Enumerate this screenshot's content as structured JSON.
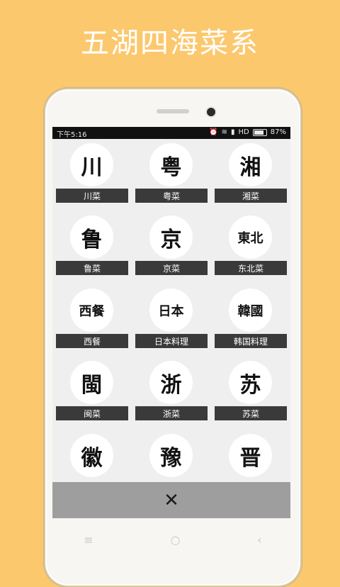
{
  "banner": {
    "title": "五湖四海菜系"
  },
  "status": {
    "time": "下午5:16",
    "network": "HD",
    "battery": "87%"
  },
  "cuisines": [
    {
      "glyph": "川",
      "label": "川菜"
    },
    {
      "glyph": "粤",
      "label": "粤菜"
    },
    {
      "glyph": "湘",
      "label": "湘菜"
    },
    {
      "glyph": "鲁",
      "label": "鲁菜"
    },
    {
      "glyph": "京",
      "label": "京菜"
    },
    {
      "glyph": "東北",
      "label": "东北菜"
    },
    {
      "glyph": "西餐",
      "label": "西餐"
    },
    {
      "glyph": "日本",
      "label": "日本料理"
    },
    {
      "glyph": "韓國",
      "label": "韩国料理"
    },
    {
      "glyph": "閩",
      "label": "闽菜"
    },
    {
      "glyph": "浙",
      "label": "浙菜"
    },
    {
      "glyph": "苏",
      "label": "苏菜"
    },
    {
      "glyph": "徽",
      "label": ""
    },
    {
      "glyph": "豫",
      "label": ""
    },
    {
      "glyph": "晋",
      "label": ""
    }
  ],
  "close_button": {
    "symbol": "✕"
  },
  "nav": {
    "menu": "≡",
    "home": "○",
    "back": "‹"
  },
  "colors": {
    "background": "#FCC86E",
    "label_bg": "#3a3a3a",
    "close_bar": "#9e9e9e"
  }
}
